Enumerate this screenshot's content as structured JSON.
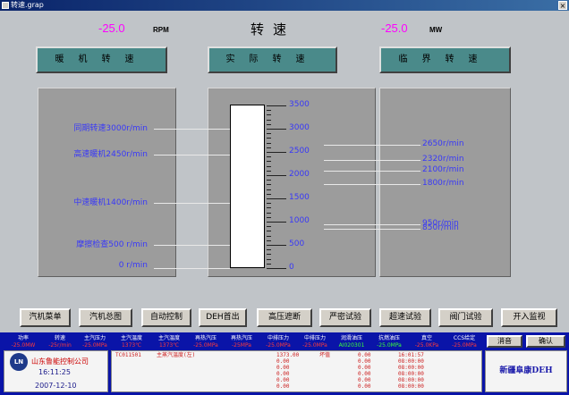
{
  "window": {
    "title": "转速.grap",
    "close": "×"
  },
  "readouts": {
    "left_value": "-25.0",
    "left_unit": "RPM",
    "right_value": "-25.0",
    "right_unit": "MW",
    "title": "转速"
  },
  "labels": {
    "warm": "暖机转速",
    "actual": "实际转速",
    "critical": "临界转速"
  },
  "left_panel": [
    {
      "text": "同期转速3000r/min",
      "value": 3000
    },
    {
      "text": "高速暖机2450r/min",
      "value": 2450
    },
    {
      "text": "中速暖机1400r/min",
      "value": 1400
    },
    {
      "text": "摩擦检查500 r/min",
      "value": 500
    },
    {
      "text": "0 r/min",
      "value": 0
    }
  ],
  "right_panel": [
    {
      "text": "2650r/min",
      "value": 2650
    },
    {
      "text": "2320r/min",
      "value": 2320
    },
    {
      "text": "2100r/min",
      "value": 2100
    },
    {
      "text": "1800r/min",
      "value": 1800
    },
    {
      "text": "950r/min",
      "value": 950
    },
    {
      "text": "850r/min",
      "value": 850
    }
  ],
  "scale": {
    "max": 3500,
    "min": 0,
    "labels": [
      "3500",
      "3000",
      "2500",
      "2000",
      "1500",
      "1000",
      "500",
      "0"
    ],
    "current": 0
  },
  "buttons": [
    "汽机菜单",
    "汽机总图",
    "自动控制",
    "DEH首出",
    "高压遮断",
    "严密试验",
    "超速试验",
    "阀门试验",
    "开入监视"
  ],
  "status_headers": [
    {
      "h": "功率",
      "v": "-25.0MW",
      "c": "red"
    },
    {
      "h": "转速",
      "v": "-25r/min",
      "c": "red"
    },
    {
      "h": "主汽压力",
      "v": "-25.0MPa",
      "c": "red"
    },
    {
      "h": "主汽温度",
      "v": "1373℃",
      "c": "red"
    },
    {
      "h": "主汽温度",
      "v": "1373℃",
      "c": "red"
    },
    {
      "h": "再热汽压",
      "v": "-25.0MPa",
      "c": "red"
    },
    {
      "h": "再热汽压",
      "v": "-25MPa",
      "c": "red"
    },
    {
      "h": "中排压力",
      "v": "-25.0MPa",
      "c": "red"
    },
    {
      "h": "中排压力",
      "v": "-25.0MPa",
      "c": "red"
    },
    {
      "h": "润滑油压",
      "v": "AI020301",
      "c": "green"
    },
    {
      "h": "抗燃油压",
      "v": "-25.0MPa",
      "c": "green"
    },
    {
      "h": "真空",
      "v": "-25.0KPa",
      "c": "red"
    },
    {
      "h": "CCS给定",
      "v": "-25.0MPa",
      "c": "red"
    }
  ],
  "logo": {
    "mark": "LN",
    "company": "山东鲁能控制公司",
    "time": "16:11:25",
    "date": "2007-12-10"
  },
  "alarm": {
    "col1": "TC011501",
    "col2": "主蒸汽温度(左)",
    "col3": "1373.00\n0.00\n0.00\n0.00\n0.00\n0.00",
    "col4": "坏值",
    "col5": "0.00\n0.00\n0.00\n0.00\n0.00\n0.00",
    "col6": "16:01:57\n08:00:00\n08:00:00\n08:00:00\n08:00:00\n08:00:00"
  },
  "right_buttons": {
    "clear": "消音",
    "confirm": "确认"
  },
  "brand": "新疆阜康DEH"
}
